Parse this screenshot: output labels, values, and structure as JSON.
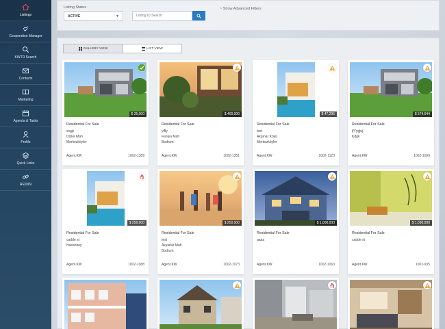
{
  "sidebar": {
    "items": [
      {
        "label": "Listings",
        "icon": "home-icon"
      },
      {
        "label": "Cooperation Manager",
        "icon": "handshake-icon"
      },
      {
        "label": "KWTR Search",
        "icon": "search-icon"
      },
      {
        "label": "Contacts",
        "icon": "envelope-icon"
      },
      {
        "label": "Marketing",
        "icon": "book-icon"
      },
      {
        "label": "Agenda & Tasks",
        "icon": "calendar-icon"
      },
      {
        "label": "Profile",
        "icon": "user-icon"
      },
      {
        "label": "Quick Links",
        "icon": "layers-icon"
      },
      {
        "label": "REIDIN",
        "icon": "link-icon"
      }
    ]
  },
  "filters": {
    "listing_status_label": "Listing Status",
    "listing_status_value": "ACTIVE",
    "id_search_placeholder": "Listing ID Search",
    "advanced_filters": "~ Show Advanced Filters"
  },
  "view_toggle": {
    "gallery": "GALLERY VIEW",
    "list": "LIST VIEW"
  },
  "listings": [
    {
      "price": "$ 25,000",
      "type": "Residential For Sale",
      "lines": [
        "sxgjx",
        "Dizler Mah",
        "Merkezköyler"
      ],
      "agent": "Agent.KW",
      "id": "1002-1389",
      "badge": "check-icon"
    },
    {
      "price": "$ 400,000",
      "type": "Residential For Sale",
      "lines": [
        "yfffy",
        "Fanlya Mah",
        "Bodrum"
      ],
      "agent": "Agent.KW",
      "id": "1002-1351",
      "badge": "warning-icon"
    },
    {
      "price": "$ 47,295",
      "type": "Residential For Sale",
      "lines": [
        "test",
        "Akpınar Köyü",
        "Merkezköyler"
      ],
      "agent": "Agent.KW",
      "id": "1002-1123",
      "badge": "warning-icon"
    },
    {
      "price": "$ 574,644",
      "type": "Residential For Sale",
      "lines": [
        "jfYygjuj",
        "Kdgk"
      ],
      "agent": "Agent.KW",
      "id": "1002-1099",
      "badge": "warning-icon"
    },
    {
      "price": "$ 256,000",
      "type": "Residential For Sale",
      "lines": [
        "cadde st",
        "Hasanbey"
      ],
      "agent": "Agent.KW",
      "id": "1002-1088",
      "badge": "hand-icon"
    },
    {
      "price": "$ 250,000",
      "type": "Residential For Sale",
      "lines": [
        "test",
        "Akyarlar Mah",
        "Bodrum"
      ],
      "agent": "Agent.KW",
      "id": "1002-1073",
      "badge": "warning-icon"
    },
    {
      "price": "$ 1,000,000",
      "type": "Residential For Sale",
      "lines": [
        "aaaa"
      ],
      "agent": "Agent.KW",
      "id": "1002-1063",
      "badge": "warning-icon"
    },
    {
      "price": "$ 1,090,000",
      "type": "Residential For Sale",
      "lines": [
        "cadde st"
      ],
      "agent": "Agent.KW",
      "id": "1002-935",
      "badge": "warning-icon"
    },
    {
      "badge": null
    },
    {
      "badge": "warning-icon"
    },
    {
      "badge": "hand-icon"
    },
    {
      "badge": "warning-icon"
    }
  ]
}
